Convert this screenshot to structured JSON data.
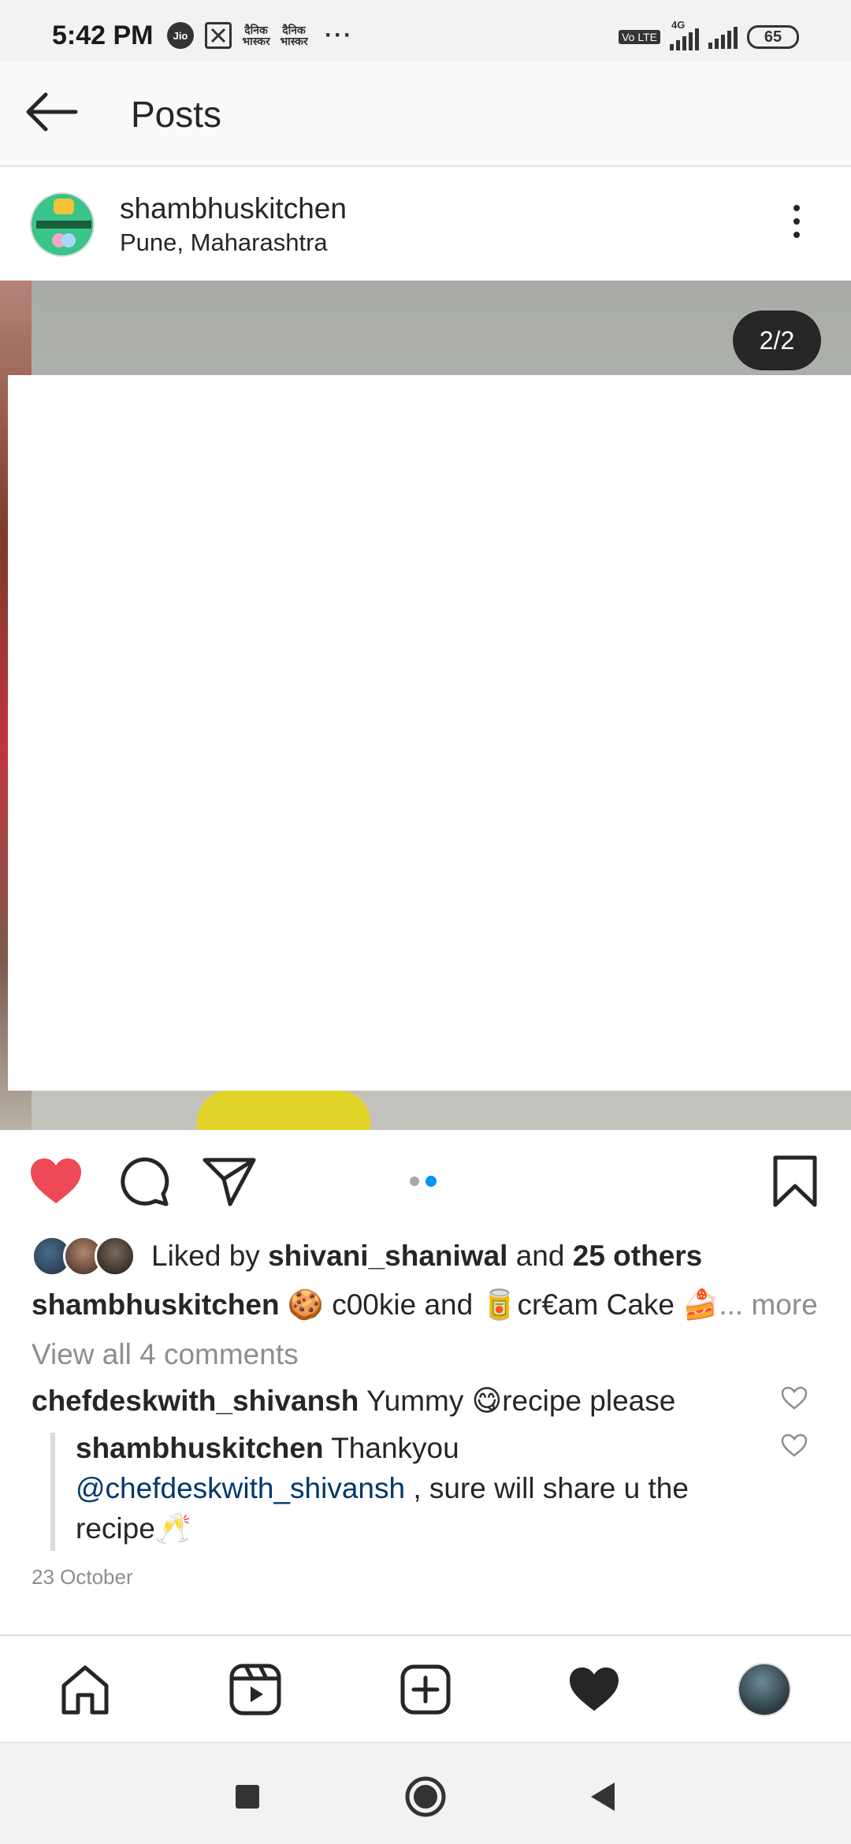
{
  "status_bar": {
    "time": "5:42 PM",
    "left_icons": [
      "jio-icon",
      "app-notification-icon",
      "news-app-icon",
      "news-app-icon",
      "more-notifications-icon"
    ],
    "jio_label": "Jio",
    "hindi_label_1": "दैनिक भास्कर",
    "hindi_label_2": "दैनिक भास्कर",
    "overflow": "···",
    "volte_label": "Vo LTE",
    "network_label": "4G",
    "battery": "65"
  },
  "header": {
    "title": "Posts",
    "back_icon": "arrow-left-icon"
  },
  "post": {
    "username": "shambhuskitchen",
    "location": "Pune, Maharashtra",
    "media_counter": "2/2",
    "carousel": {
      "total": 2,
      "current": 2
    }
  },
  "actions": {
    "liked": true,
    "like_color": "#ed4956",
    "icons": [
      "heart-filled-icon",
      "comment-icon",
      "share-icon",
      "bookmark-icon"
    ]
  },
  "likes": {
    "prefix": "Liked by",
    "user": "shivani_shaniwal",
    "conjunction": "and",
    "others": "25 others"
  },
  "caption": {
    "user": "shambhuskitchen",
    "emoji1": "🍪",
    "text1": "c00kie and",
    "emoji2": "🥫",
    "text2": "cr€am Cake",
    "emoji3": "🍰",
    "more": "... more"
  },
  "view_comments": "View all 4 comments",
  "comment": {
    "user": "chefdeskwith_shivansh",
    "text1": "Yummy",
    "emoji": "😋",
    "text2": "recipe please"
  },
  "reply": {
    "user": "shambhuskitchen",
    "text1": "Thankyou",
    "mention": "@chefdeskwith_shivansh",
    "text2": ", sure will share u the recipe",
    "emoji": "🥂"
  },
  "date": "23 October",
  "bottom_nav": [
    "home-icon",
    "reels-icon",
    "new-post-icon",
    "activity-heart-icon",
    "profile-avatar"
  ],
  "system_nav": [
    "recents-square-icon",
    "home-circle-icon",
    "back-triangle-icon"
  ]
}
